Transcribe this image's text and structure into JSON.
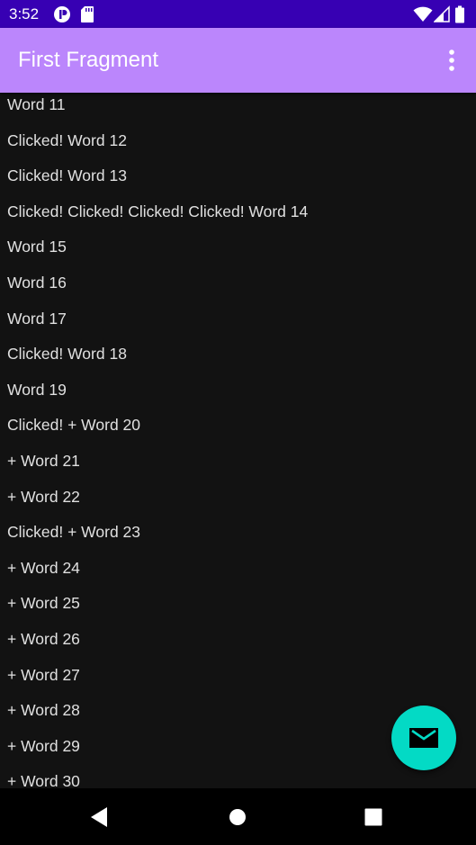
{
  "status_bar": {
    "time": "3:52",
    "background": "#3700b3",
    "icons": [
      "play-protect-icon",
      "sd-card-icon",
      "wifi-icon",
      "signal-icon",
      "battery-icon"
    ]
  },
  "app_bar": {
    "title": "First Fragment",
    "background": "#bb86fc",
    "overflow_icon": "more-vert-icon"
  },
  "list": {
    "items": [
      "Word 11",
      "Clicked! Word 12",
      "Clicked! Word 13",
      "Clicked! Clicked! Clicked! Clicked! Word 14",
      "Word 15",
      "Word 16",
      "Word 17",
      "Clicked! Word 18",
      "Word 19",
      "Clicked! + Word 20",
      "+ Word 21",
      "+ Word 22",
      "Clicked! + Word 23",
      "+ Word 24",
      "+ Word 25",
      "+ Word 26",
      "+ Word 27",
      "+ Word 28",
      "+ Word 29",
      "+ Word 30"
    ]
  },
  "fab": {
    "icon": "email-icon",
    "color": "#03dac5"
  },
  "nav_bar": {
    "buttons": [
      "back-icon",
      "home-icon",
      "recents-icon"
    ]
  }
}
